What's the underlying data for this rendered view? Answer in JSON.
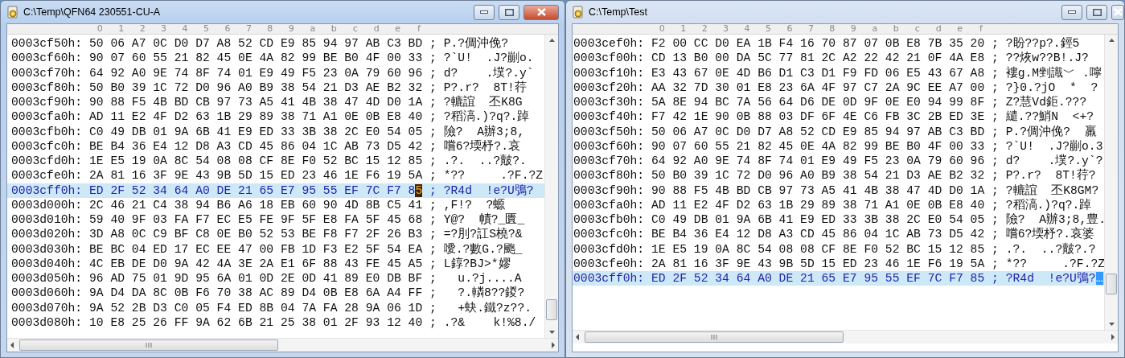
{
  "windows": [
    {
      "title": "C:\\Temp\\QFN64 230551-CU-A",
      "active": true,
      "column_headers": [
        "0",
        "1",
        "2",
        "3",
        "4",
        "5",
        "6",
        "7",
        "8",
        "9",
        "a",
        "b",
        "c",
        "d",
        "e",
        "f"
      ],
      "rows": [
        {
          "offset": "0003cf50h:",
          "hex": "50 06 A7 0C D0 D7 A8 52 CD E9 85 94 97 AB C3 BD",
          "separator": ";",
          "ascii": "P.?倜沖俛?",
          "selected": false
        },
        {
          "offset": "0003cf60h:",
          "hex": "90 07 60 55 21 82 45 0E 4A 82 99 BE B0 4F 00 33",
          "separator": ";",
          "ascii": "?`U!  .J?剻o.",
          "selected": false
        },
        {
          "offset": "0003cf70h:",
          "hex": "64 92 A0 9E 74 8F 74 01 E9 49 F5 23 0A 79 60 96",
          "separator": ";",
          "ascii": "d?    .墣?.y`",
          "selected": false
        },
        {
          "offset": "0003cf80h:",
          "hex": "50 B0 39 1C 72 D0 96 A0 B9 38 54 21 D3 AE B2 32",
          "separator": ";",
          "ascii": "P?.r?  8T!荇",
          "selected": false
        },
        {
          "offset": "0003cf90h:",
          "hex": "90 88 F5 4B BD CB 97 73 A5 41 4B 38 47 4D D0 1A",
          "separator": ";",
          "ascii": "?轆誼  丕K8G",
          "selected": false
        },
        {
          "offset": "0003cfa0h:",
          "hex": "AD 11 E2 4F D2 63 1B 29 89 38 71 A1 0E 0B E8 40",
          "separator": ";",
          "ascii": "?稻滈.)?q?.踔",
          "selected": false
        },
        {
          "offset": "0003cfb0h:",
          "hex": "C0 49 DB 01 9A 6B 41 E9 ED 33 3B 38 2C E0 54 05",
          "separator": ";",
          "ascii": "險?  A辦3;8,",
          "selected": false
        },
        {
          "offset": "0003cfc0h:",
          "hex": "BE B4 36 E4 12 D8 A3 CD 45 86 04 1C AB 73 D5 42",
          "separator": ";",
          "ascii": "嚐6?堧杼?.哀",
          "selected": false
        },
        {
          "offset": "0003cfd0h:",
          "hex": "1E E5 19 0A 8C 54 08 08 CF 8E F0 52 BC 15 12 85",
          "separator": ";",
          "ascii": ".?.  ..?皾?.",
          "selected": false
        },
        {
          "offset": "0003cfe0h:",
          "hex": "2A 81 16 3F 9E 43 9B 5D 15 ED 23 46 1E F6 19 5A",
          "separator": ";",
          "ascii": "*??     .?F.?Z",
          "selected": false
        },
        {
          "offset": "0003cff0h:",
          "hex": "ED 2F 52 34 64 A0 DE 21 65 E7 95 55 EF 7C F7 8",
          "hex_cursor": "5",
          "separator": ";",
          "ascii": "?R4d  !e?U鴞?",
          "selected": true
        },
        {
          "offset": "0003d000h:",
          "hex": "2C 46 21 C4 38 94 B6 A6 18 EB 60 90 4D 8B C5 41",
          "separator": ";",
          "ascii": ",F!?  ?螈",
          "selected": false
        },
        {
          "offset": "0003d010h:",
          "hex": "59 40 9F 03 FA F7 EC E5 FE 9F 5F E8 FA 5F 45 68",
          "separator": ";",
          "ascii": "Y@?  幘?_匱_",
          "selected": false
        },
        {
          "offset": "0003d020h:",
          "hex": "3D A8 0C C9 BF C8 0E B0 52 53 BE F8 F7 2F 26 B3",
          "separator": ";",
          "ascii": "=?刖?訌S橈?&",
          "selected": false
        },
        {
          "offset": "0003d030h:",
          "hex": "BE BC 04 ED 17 EC EE 47 00 FB 1D F3 E2 5F 54 EA",
          "separator": ";",
          "ascii": "噯.?數G.?颮_",
          "selected": false
        },
        {
          "offset": "0003d040h:",
          "hex": "4C EB DE D0 9A 42 4A 3E 2A E1 6F 88 43 FE 45 A5",
          "separator": ";",
          "ascii": "L錞?BJ>*嫪",
          "selected": false
        },
        {
          "offset": "0003d050h:",
          "hex": "96 AD 75 01 9D 95 6A 01 0D 2E 0D 41 89 E0 DB BF",
          "separator": ";",
          "ascii": "  u.?j....A",
          "selected": false
        },
        {
          "offset": "0003d060h:",
          "hex": "9A D4 DA 8C 0B F6 70 38 AC 89 D4 0B E8 6A A4 FF",
          "separator": ";",
          "ascii": "  ?.轔8??鍐?",
          "selected": false
        },
        {
          "offset": "0003d070h:",
          "hex": "9A 52 2B D3 C0 05 F4 ED 8B 04 7A FA 28 9A 06 1D",
          "separator": ";",
          "ascii": "  +蚗.鐵?z??.",
          "selected": false
        },
        {
          "offset": "0003d080h:",
          "hex": "10 E8 25 26 FF 9A 62 6B 21 25 38 01 2F 93 12 40",
          "separator": ";",
          "ascii": ".?&    k!%8./",
          "selected": false
        }
      ]
    },
    {
      "title": "C:\\Temp\\Test",
      "active": false,
      "column_headers": [
        "0",
        "1",
        "2",
        "3",
        "4",
        "5",
        "6",
        "7",
        "8",
        "9",
        "a",
        "b",
        "c",
        "d",
        "e",
        "f"
      ],
      "rows": [
        {
          "offset": "0003cef0h:",
          "hex": "F2 00 CC D0 EA 1B F4 16 70 87 07 0B E8 7B 35 20",
          "separator": ";",
          "ascii": "?盼??p?.鋞5",
          "selected": false
        },
        {
          "offset": "0003cf00h:",
          "hex": "CD 13 B0 00 DA 5C 77 81 2C A2 22 42 21 0F 4A E8",
          "separator": ";",
          "ascii": "??烣w??B!.J?",
          "selected": false
        },
        {
          "offset": "0003cf10h:",
          "hex": "E3 43 67 0E 4D B6 D1 C3 D1 F9 FD 06 E5 43 67 A8",
          "separator": ";",
          "ascii": "褸g.M剉識﹀ .嚀",
          "selected": false
        },
        {
          "offset": "0003cf20h:",
          "hex": "AA 32 7D 30 01 E8 23 6A 4F 97 C7 2A 9C EE A7 00",
          "separator": ";",
          "ascii": "?}0.?jO  *  ?",
          "selected": false
        },
        {
          "offset": "0003cf30h:",
          "hex": "5A 8E 94 BC 7A 56 64 D6 DE 0D 9F 0E E0 94 99 8F",
          "separator": ";",
          "ascii": "Z?慧Vd鉅.???",
          "selected": false
        },
        {
          "offset": "0003cf40h:",
          "hex": "F7 42 1E 90 0B 88 03 DF 6F 4E C6 FB 3C 2B ED 3E",
          "separator": ";",
          "ascii": "繾.??鮹N  <+?",
          "selected": false
        },
        {
          "offset": "0003cf50h:",
          "hex": "50 06 A7 0C D0 D7 A8 52 CD E9 85 94 97 AB C3 BD",
          "separator": ";",
          "ascii": "P.?倜沖俛?  羸",
          "selected": false
        },
        {
          "offset": "0003cf60h:",
          "hex": "90 07 60 55 21 82 45 0E 4A 82 99 BE B0 4F 00 33",
          "separator": ";",
          "ascii": "?`U!  .J?剻o.3",
          "selected": false
        },
        {
          "offset": "0003cf70h:",
          "hex": "64 92 A0 9E 74 8F 74 01 E9 49 F5 23 0A 79 60 96",
          "separator": ";",
          "ascii": "d?    .墣?.y`?",
          "selected": false
        },
        {
          "offset": "0003cf80h:",
          "hex": "50 B0 39 1C 72 D0 96 A0 B9 38 54 21 D3 AE B2 32",
          "separator": ";",
          "ascii": "P?.r?  8T!荇?",
          "selected": false
        },
        {
          "offset": "0003cf90h:",
          "hex": "90 88 F5 4B BD CB 97 73 A5 41 4B 38 47 4D D0 1A",
          "separator": ";",
          "ascii": "?轆誼  丕K8GM?",
          "selected": false
        },
        {
          "offset": "0003cfa0h:",
          "hex": "AD 11 E2 4F D2 63 1B 29 89 38 71 A1 0E 0B E8 40",
          "separator": ";",
          "ascii": "?稻滈.)?q?.踔",
          "selected": false
        },
        {
          "offset": "0003cfb0h:",
          "hex": "C0 49 DB 01 9A 6B 41 E9 ED 33 3B 38 2C E0 54 05",
          "separator": ";",
          "ascii": "險?  A辦3;8,豊.",
          "selected": false
        },
        {
          "offset": "0003cfc0h:",
          "hex": "BE B4 36 E4 12 D8 A3 CD 45 86 04 1C AB 73 D5 42",
          "separator": ";",
          "ascii": "嚐6?堧杼?.哀婆",
          "selected": false
        },
        {
          "offset": "0003cfd0h:",
          "hex": "1E E5 19 0A 8C 54 08 08 CF 8E F0 52 BC 15 12 85",
          "separator": ";",
          "ascii": ".?.  ..?皾?.?",
          "selected": false
        },
        {
          "offset": "0003cfe0h:",
          "hex": "2A 81 16 3F 9E 43 9B 5D 15 ED 23 46 1E F6 19 5A",
          "separator": ";",
          "ascii": "*??     .?F.?Z",
          "selected": false
        },
        {
          "offset": "0003cff0h:",
          "hex": "ED 2F 52 34 64 A0 DE 21 65 E7 95 55 EF 7C F7 85",
          "separator": ";",
          "ascii": "?R4d  !e?U鴞?",
          "ascii_cursor": "…",
          "selected": true
        }
      ]
    }
  ]
}
